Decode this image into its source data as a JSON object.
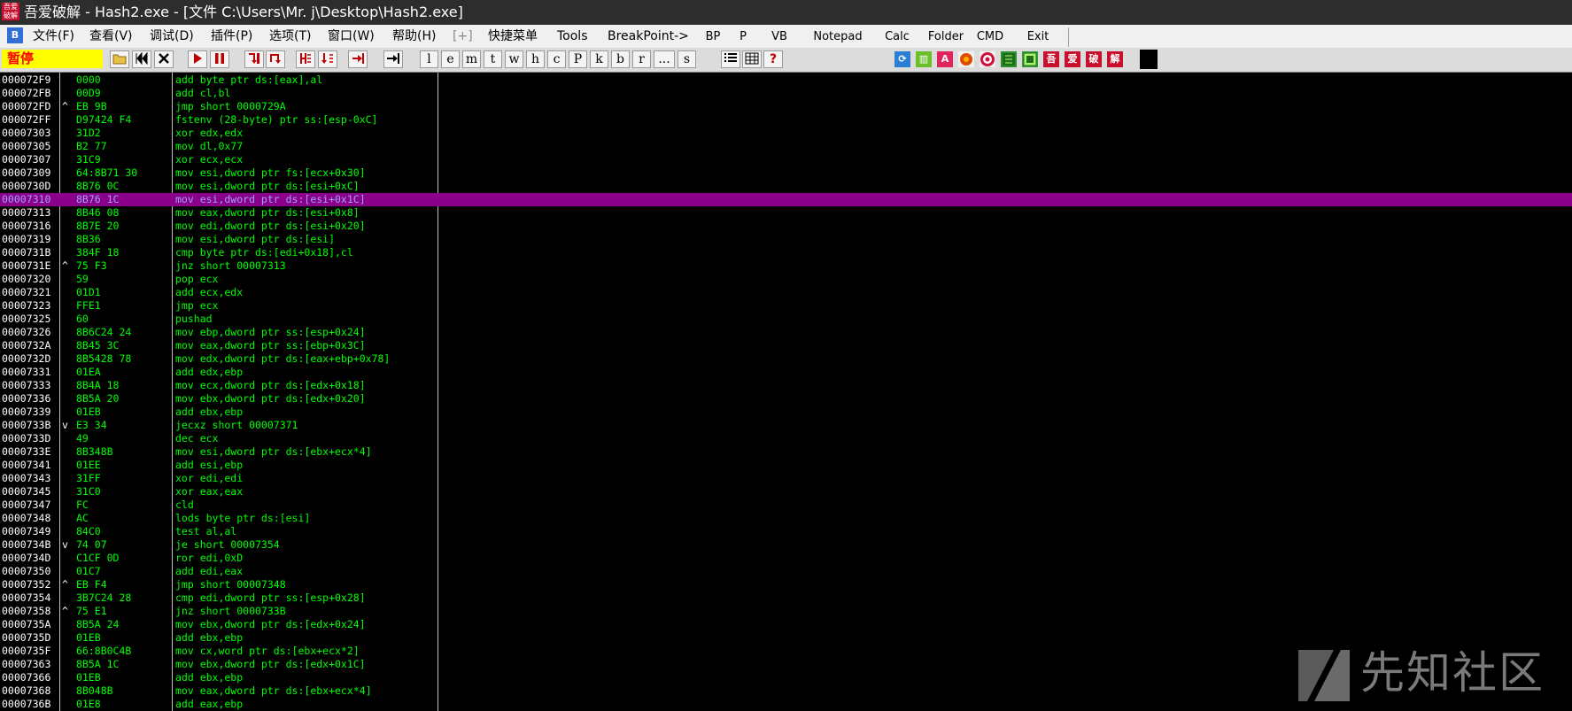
{
  "window": {
    "icon_text": "吾爱破解",
    "title": "吾爱破解 - Hash2.exe - [文件 C:\\Users\\Mr. j\\Desktop\\Hash2.exe]"
  },
  "menu": {
    "app_icon": "B",
    "items": [
      "文件(F)",
      "查看(V)",
      "调试(D)",
      "插件(P)",
      "选项(T)",
      "窗口(W)",
      "帮助(H)",
      "[+]",
      "快捷菜单",
      "Tools",
      "BreakPoint->"
    ]
  },
  "plugin_buttons": [
    "BP",
    "P",
    "VB",
    "Notepad",
    "Calc",
    "Folder",
    "CMD",
    "Exit"
  ],
  "toolbar": {
    "status": "暂停",
    "letter_buttons": [
      "l",
      "e",
      "m",
      "t",
      "w",
      "h",
      "c",
      "P",
      "k",
      "b",
      "r",
      "...",
      "s"
    ],
    "question": "?",
    "brand_chars": [
      "吾",
      "爱",
      "破",
      "解"
    ],
    "a_icon": "A"
  },
  "icons": {
    "open": "open-folder-icon",
    "restart": "restart-icon",
    "close": "close-icon",
    "run": "run-icon",
    "pause": "pause-icon",
    "step_into": "step-into-icon",
    "step_over": "step-over-icon",
    "trace_into": "trace-into-icon",
    "trace_over": "trace-over-icon",
    "execute_till_return": "execute-till-return-icon",
    "go_to": "go-to-icon"
  },
  "colors": {
    "selected_row": "#8b008b",
    "code_text": "#00ff00",
    "address_text": "#ffffff",
    "status_bg": "#ffff00",
    "status_text": "#ff0000"
  },
  "disassembly": [
    {
      "addr": "000072F9",
      "jmp": "",
      "hex": "0000",
      "asm": "add byte ptr ds:[eax],al"
    },
    {
      "addr": "000072FB",
      "jmp": "",
      "hex": "00D9",
      "asm": "add cl,bl"
    },
    {
      "addr": "000072FD",
      "jmp": "^",
      "hex": "EB 9B",
      "asm": "jmp short 0000729A"
    },
    {
      "addr": "000072FF",
      "jmp": "",
      "hex": "D97424 F4",
      "asm": "fstenv (28-byte) ptr ss:[esp-0xC]"
    },
    {
      "addr": "00007303",
      "jmp": "",
      "hex": "31D2",
      "asm": "xor edx,edx"
    },
    {
      "addr": "00007305",
      "jmp": "",
      "hex": "B2 77",
      "asm": "mov dl,0x77"
    },
    {
      "addr": "00007307",
      "jmp": "",
      "hex": "31C9",
      "asm": "xor ecx,ecx"
    },
    {
      "addr": "00007309",
      "jmp": "",
      "hex": "64:8B71 30",
      "asm": "mov esi,dword ptr fs:[ecx+0x30]"
    },
    {
      "addr": "0000730D",
      "jmp": "",
      "hex": "8B76 0C",
      "asm": "mov esi,dword ptr ds:[esi+0xC]"
    },
    {
      "addr": "00007310",
      "jmp": "",
      "hex": "8B76 1C",
      "asm": "mov esi,dword ptr ds:[esi+0x1C]",
      "selected": true
    },
    {
      "addr": "00007313",
      "jmp": "",
      "hex": "8B46 08",
      "asm": "mov eax,dword ptr ds:[esi+0x8]"
    },
    {
      "addr": "00007316",
      "jmp": "",
      "hex": "8B7E 20",
      "asm": "mov edi,dword ptr ds:[esi+0x20]"
    },
    {
      "addr": "00007319",
      "jmp": "",
      "hex": "8B36",
      "asm": "mov esi,dword ptr ds:[esi]"
    },
    {
      "addr": "0000731B",
      "jmp": "",
      "hex": "384F 18",
      "asm": "cmp byte ptr ds:[edi+0x18],cl"
    },
    {
      "addr": "0000731E",
      "jmp": "^",
      "hex": "75 F3",
      "asm": "jnz short 00007313"
    },
    {
      "addr": "00007320",
      "jmp": "",
      "hex": "59",
      "asm": "pop ecx"
    },
    {
      "addr": "00007321",
      "jmp": "",
      "hex": "01D1",
      "asm": "add ecx,edx"
    },
    {
      "addr": "00007323",
      "jmp": "",
      "hex": "FFE1",
      "asm": "jmp ecx"
    },
    {
      "addr": "00007325",
      "jmp": "",
      "hex": "60",
      "asm": "pushad"
    },
    {
      "addr": "00007326",
      "jmp": "",
      "hex": "8B6C24 24",
      "asm": "mov ebp,dword ptr ss:[esp+0x24]"
    },
    {
      "addr": "0000732A",
      "jmp": "",
      "hex": "8B45 3C",
      "asm": "mov eax,dword ptr ss:[ebp+0x3C]"
    },
    {
      "addr": "0000732D",
      "jmp": "",
      "hex": "8B5428 78",
      "asm": "mov edx,dword ptr ds:[eax+ebp+0x78]"
    },
    {
      "addr": "00007331",
      "jmp": "",
      "hex": "01EA",
      "asm": "add edx,ebp"
    },
    {
      "addr": "00007333",
      "jmp": "",
      "hex": "8B4A 18",
      "asm": "mov ecx,dword ptr ds:[edx+0x18]"
    },
    {
      "addr": "00007336",
      "jmp": "",
      "hex": "8B5A 20",
      "asm": "mov ebx,dword ptr ds:[edx+0x20]"
    },
    {
      "addr": "00007339",
      "jmp": "",
      "hex": "01EB",
      "asm": "add ebx,ebp"
    },
    {
      "addr": "0000733B",
      "jmp": "v",
      "hex": "E3 34",
      "asm": "jecxz short 00007371"
    },
    {
      "addr": "0000733D",
      "jmp": "",
      "hex": "49",
      "asm": "dec ecx"
    },
    {
      "addr": "0000733E",
      "jmp": "",
      "hex": "8B348B",
      "asm": "mov esi,dword ptr ds:[ebx+ecx*4]"
    },
    {
      "addr": "00007341",
      "jmp": "",
      "hex": "01EE",
      "asm": "add esi,ebp"
    },
    {
      "addr": "00007343",
      "jmp": "",
      "hex": "31FF",
      "asm": "xor edi,edi"
    },
    {
      "addr": "00007345",
      "jmp": "",
      "hex": "31C0",
      "asm": "xor eax,eax"
    },
    {
      "addr": "00007347",
      "jmp": "",
      "hex": "FC",
      "asm": "cld"
    },
    {
      "addr": "00007348",
      "jmp": "",
      "hex": "AC",
      "asm": "lods byte ptr ds:[esi]"
    },
    {
      "addr": "00007349",
      "jmp": "",
      "hex": "84C0",
      "asm": "test al,al"
    },
    {
      "addr": "0000734B",
      "jmp": "v",
      "hex": "74 07",
      "asm": "je short 00007354"
    },
    {
      "addr": "0000734D",
      "jmp": "",
      "hex": "C1CF 0D",
      "asm": "ror edi,0xD"
    },
    {
      "addr": "00007350",
      "jmp": "",
      "hex": "01C7",
      "asm": "add edi,eax"
    },
    {
      "addr": "00007352",
      "jmp": "^",
      "hex": "EB F4",
      "asm": "jmp short 00007348"
    },
    {
      "addr": "00007354",
      "jmp": "",
      "hex": "3B7C24 28",
      "asm": "cmp edi,dword ptr ss:[esp+0x28]"
    },
    {
      "addr": "00007358",
      "jmp": "^",
      "hex": "75 E1",
      "asm": "jnz short 0000733B"
    },
    {
      "addr": "0000735A",
      "jmp": "",
      "hex": "8B5A 24",
      "asm": "mov ebx,dword ptr ds:[edx+0x24]"
    },
    {
      "addr": "0000735D",
      "jmp": "",
      "hex": "01EB",
      "asm": "add ebx,ebp"
    },
    {
      "addr": "0000735F",
      "jmp": "",
      "hex": "66:8B0C4B",
      "asm": "mov cx,word ptr ds:[ebx+ecx*2]"
    },
    {
      "addr": "00007363",
      "jmp": "",
      "hex": "8B5A 1C",
      "asm": "mov ebx,dword ptr ds:[edx+0x1C]"
    },
    {
      "addr": "00007366",
      "jmp": "",
      "hex": "01EB",
      "asm": "add ebx,ebp"
    },
    {
      "addr": "00007368",
      "jmp": "",
      "hex": "8B048B",
      "asm": "mov eax,dword ptr ds:[ebx+ecx*4]"
    },
    {
      "addr": "0000736B",
      "jmp": "",
      "hex": "01E8",
      "asm": "add eax,ebp"
    }
  ],
  "watermark": {
    "text": "先知社区"
  }
}
